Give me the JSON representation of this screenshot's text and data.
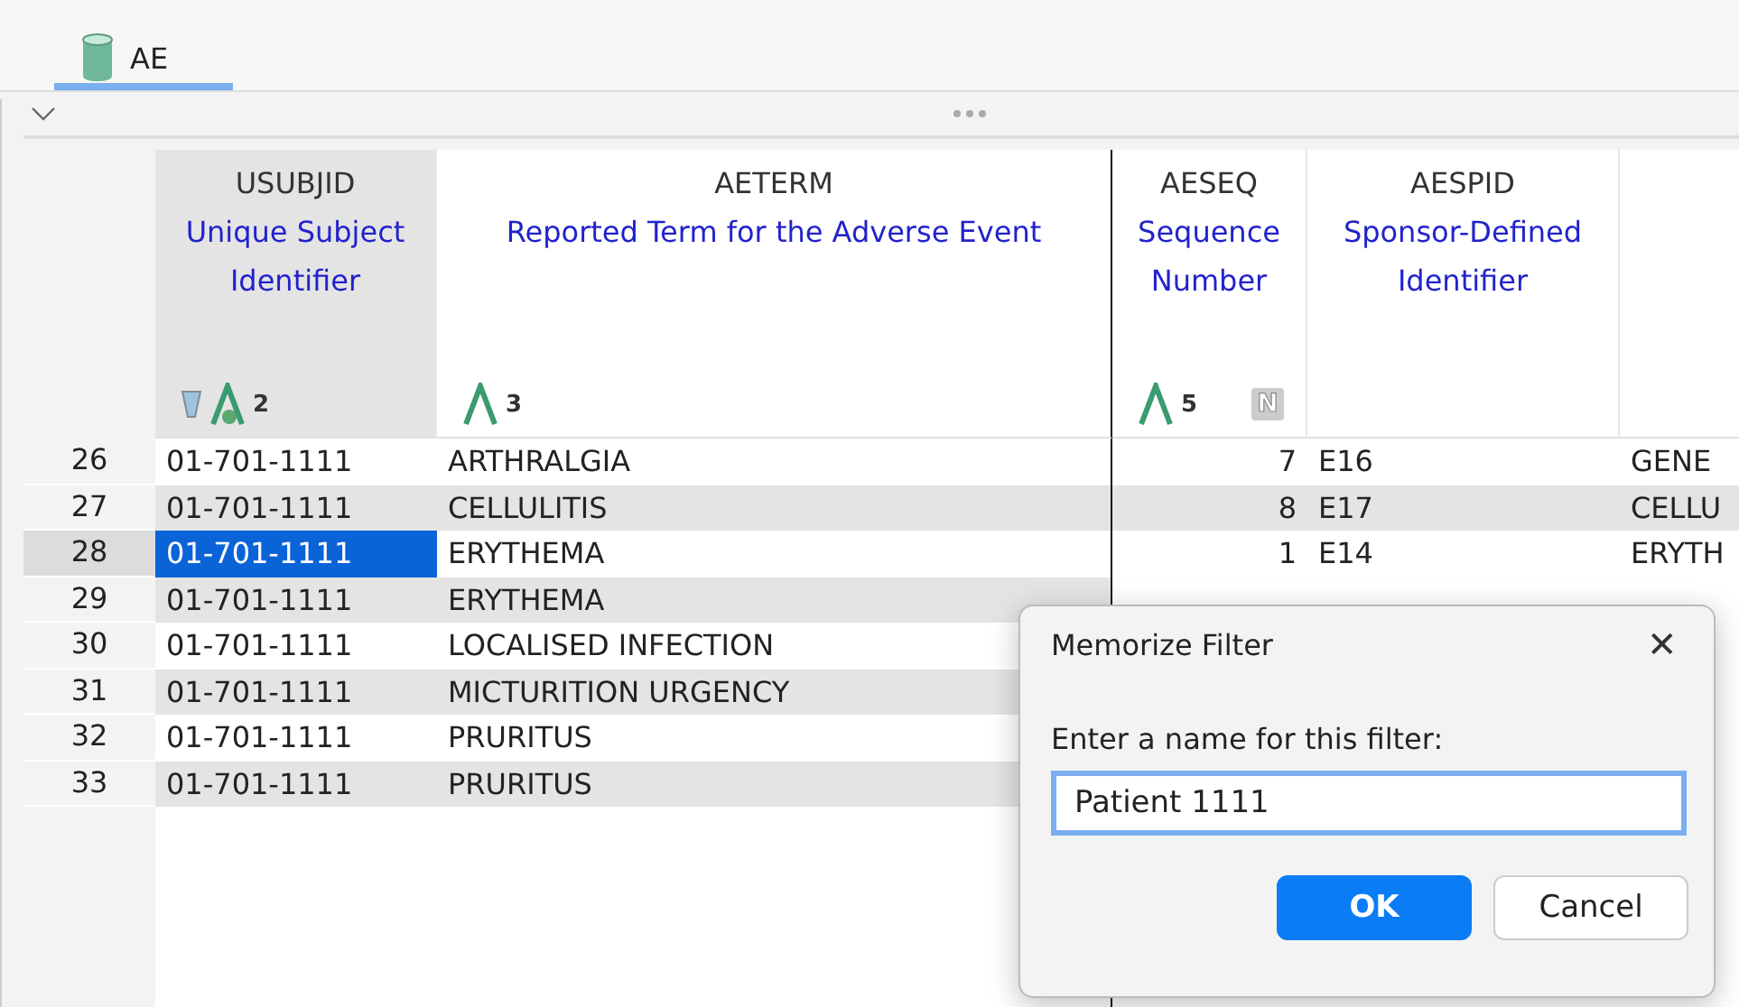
{
  "tabs": [
    {
      "label": "AE",
      "selected": true
    }
  ],
  "table": {
    "columns": [
      {
        "name": "USUBJID",
        "label": "Unique Subject Identifier",
        "selected": true,
        "filtered": true,
        "sort": "2",
        "numeric": false
      },
      {
        "name": "AETERM",
        "label": "Reported Term for the Adverse Event",
        "selected": false,
        "filtered": false,
        "sort": "3",
        "numeric": false
      },
      {
        "name": "AESEQ",
        "label": "Sequence Number",
        "selected": false,
        "filtered": false,
        "sort": "5",
        "numeric": true,
        "badge": "N"
      },
      {
        "name": "AESPID",
        "label": "Sponsor-Defined Identifier",
        "selected": false,
        "filtered": false,
        "numeric": false
      },
      {
        "selected": false,
        "filtered": false,
        "numeric": false
      }
    ],
    "rows": [
      {
        "number": "26",
        "selected": false,
        "cells": [
          "01-701-1111",
          "ARTHRALGIA",
          "7",
          "E16",
          "GENE"
        ]
      },
      {
        "number": "27",
        "selected": false,
        "cells": [
          "01-701-1111",
          "CELLULITIS",
          "8",
          "E17",
          "CELLU"
        ]
      },
      {
        "number": "28",
        "selected": true,
        "cells": [
          "01-701-1111",
          "ERYTHEMA",
          "1",
          "E14",
          "ERYTH"
        ]
      },
      {
        "number": "29",
        "selected": false,
        "cells": [
          "01-701-1111",
          "ERYTHEMA"
        ]
      },
      {
        "number": "30",
        "selected": false,
        "cells": [
          "01-701-1111",
          "LOCALISED INFECTION"
        ]
      },
      {
        "number": "31",
        "selected": false,
        "cells": [
          "01-701-1111",
          "MICTURITION URGENCY"
        ]
      },
      {
        "number": "32",
        "selected": false,
        "cells": [
          "01-701-1111",
          "PRURITUS"
        ]
      },
      {
        "number": "33",
        "selected": false,
        "cells": [
          "01-701-1111",
          "PRURITUS"
        ]
      }
    ]
  },
  "dialog": {
    "title": "Memorize Filter",
    "close": "✕",
    "prompt": "Enter a name for this filter:",
    "value": "Patient 1111",
    "buttons": [
      {
        "label": "OK",
        "primary": true
      },
      {
        "label": "Cancel",
        "primary": false
      }
    ]
  }
}
